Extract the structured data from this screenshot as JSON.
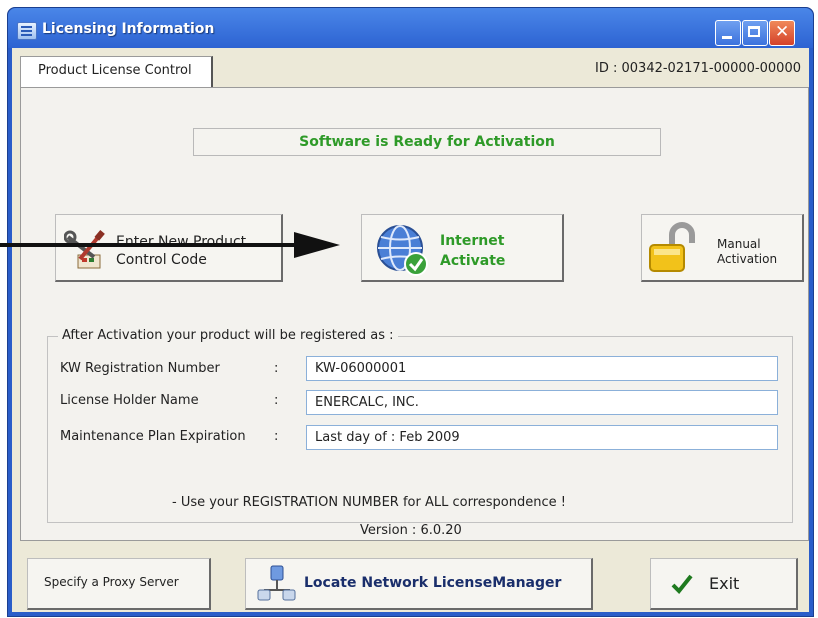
{
  "window": {
    "title": "Licensing Information",
    "min_glyph": "",
    "max_glyph": "",
    "close_glyph": "✕"
  },
  "tabs": [
    {
      "label": "Product License Control"
    }
  ],
  "id_text": "ID : 00342-02171-00000-00000",
  "status": "Software is Ready for Activation",
  "buttons": {
    "enter_line1": "Enter New Product",
    "enter_line2": "Control Code",
    "internet_line1": "Internet",
    "internet_line2": "Activate",
    "manual_line1": "Manual",
    "manual_line2": "Activation"
  },
  "registration": {
    "legend": "After Activation your product will be registered as :",
    "fields": [
      {
        "label": "KW Registration Number",
        "value": "KW-06000001"
      },
      {
        "label": "License Holder Name",
        "value": "ENERCALC, INC."
      },
      {
        "label": "Maintenance Plan Expiration",
        "value": "Last day of : Feb 2009"
      }
    ],
    "colon": ":",
    "note": "-  Use your REGISTRATION NUMBER for ALL correspondence !",
    "version": "Version : 6.0.20"
  },
  "bottom": {
    "proxy_label": "Specify a Proxy Server",
    "locate_label": "Locate Network LicenseManager",
    "exit_label": "Exit"
  },
  "colors": {
    "title_blue": "#2d63d2",
    "status_green": "#2e9a28",
    "close_red": "#d4412a",
    "dialog_bg": "#ece9d8"
  }
}
